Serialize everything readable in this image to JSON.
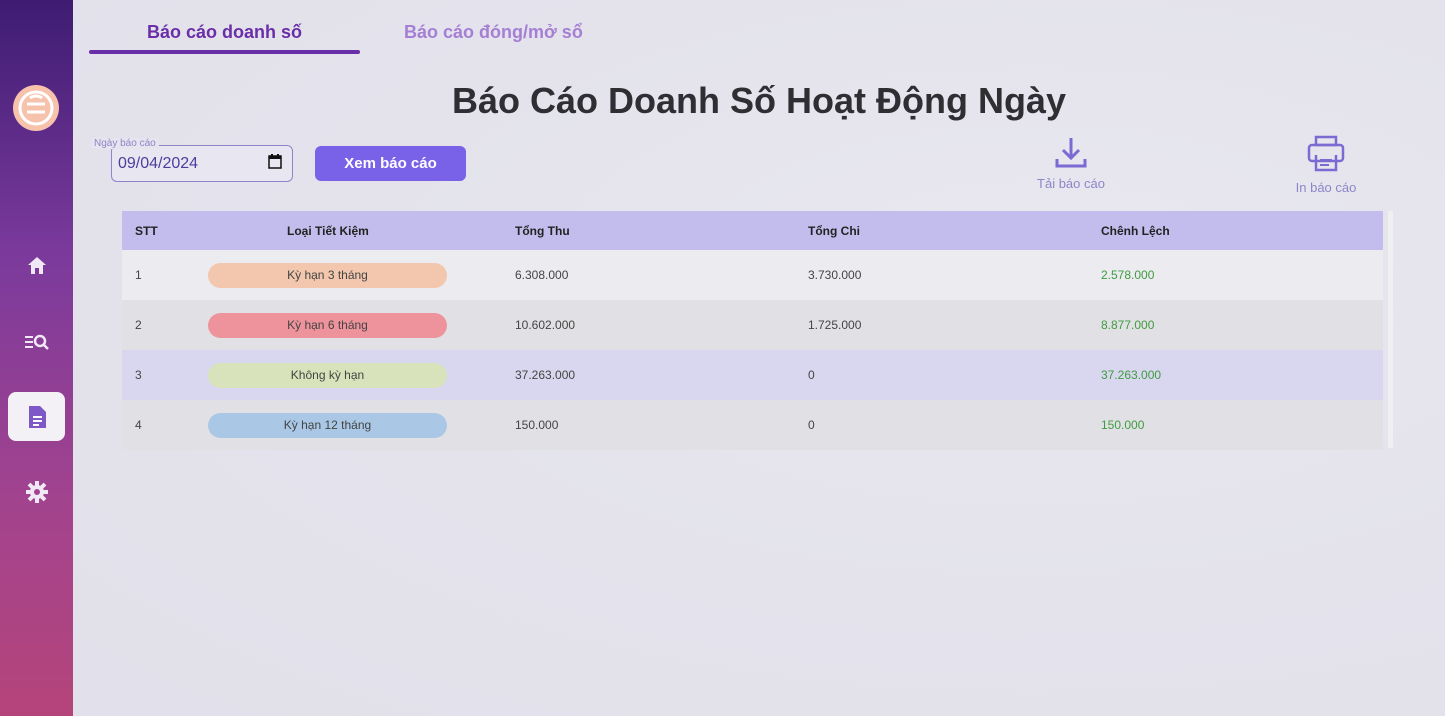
{
  "tabs": [
    {
      "label": "Báo cáo doanh số",
      "active": true
    },
    {
      "label": "Báo cáo đóng/mở sổ",
      "active": false
    }
  ],
  "title": "Báo Cáo Doanh Số Hoạt Động Ngày",
  "date_field": {
    "label": "Ngày báo cáo",
    "value": "09/04/2024"
  },
  "view_button": "Xem báo cáo",
  "actions": {
    "download": "Tải báo cáo",
    "print": "In báo cáo"
  },
  "sidebar": {
    "icons": [
      "home-icon",
      "search-list-icon",
      "document-icon",
      "gear-icon"
    ],
    "active": "document-icon"
  },
  "table": {
    "headers": [
      "STT",
      "Loại Tiết Kiệm",
      "Tổng Thu",
      "Tổng Chi",
      "Chênh Lệch"
    ],
    "rows": [
      {
        "stt": "1",
        "type": "Kỳ hạn 3 tháng",
        "color": "#f2c7ad",
        "thu": "6.308.000",
        "chi": "3.730.000",
        "diff": "2.578.000"
      },
      {
        "stt": "2",
        "type": "Kỳ hạn 6 tháng",
        "color": "#ee939c",
        "thu": "10.602.000",
        "chi": "1.725.000",
        "diff": "8.877.000"
      },
      {
        "stt": "3",
        "type": "Không kỳ hạn",
        "color": "#d9e3bb",
        "thu": "37.263.000",
        "chi": "0",
        "diff": "37.263.000"
      },
      {
        "stt": "4",
        "type": "Kỳ hạn 12 tháng",
        "color": "#aac8e6",
        "thu": "150.000",
        "chi": "0",
        "diff": "150.000"
      }
    ]
  },
  "colors": {
    "accent": "#7a62e8",
    "tab_active": "#6a2ea8",
    "positive": "#3f9b3f",
    "header_bg": "#c2bded"
  }
}
